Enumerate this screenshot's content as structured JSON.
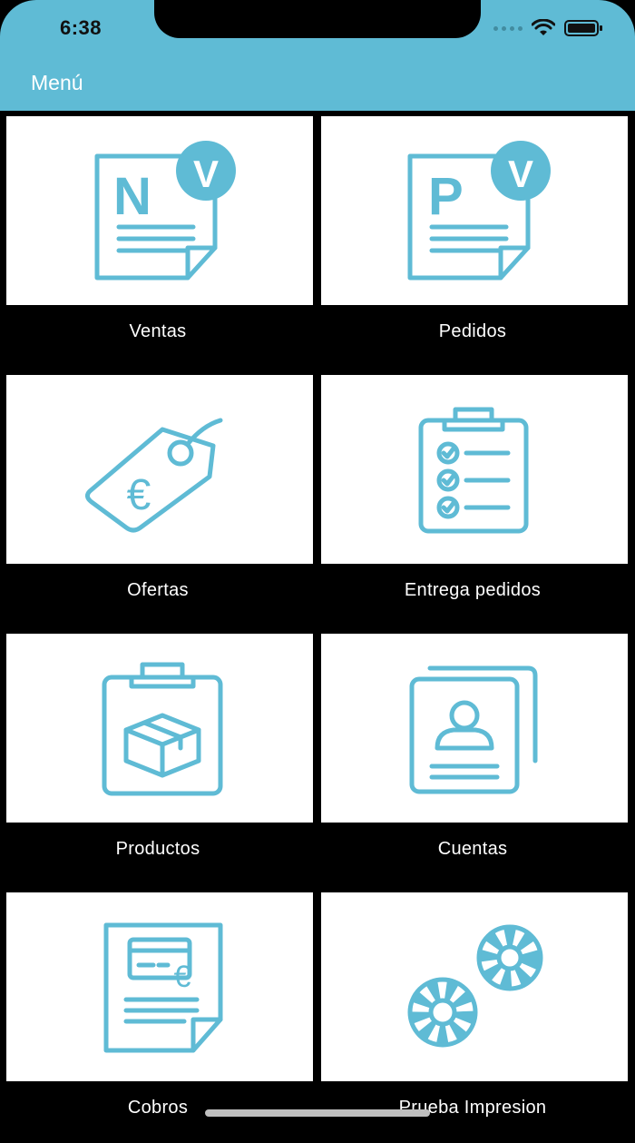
{
  "status_bar": {
    "time": "6:38"
  },
  "header": {
    "title": "Menú"
  },
  "accent_color": "#5fbbd5",
  "menu": {
    "items": [
      {
        "label": "Ventas",
        "icon": "sales-document-icon"
      },
      {
        "label": "Pedidos",
        "icon": "order-document-icon"
      },
      {
        "label": "Ofertas",
        "icon": "price-tag-euro-icon"
      },
      {
        "label": "Entrega pedidos",
        "icon": "checklist-clipboard-icon"
      },
      {
        "label": "Productos",
        "icon": "clipboard-box-icon"
      },
      {
        "label": "Cuentas",
        "icon": "account-cards-icon"
      },
      {
        "label": "Cobros",
        "icon": "payment-document-icon"
      },
      {
        "label": "Prueba Impresion",
        "icon": "gears-icon"
      }
    ]
  }
}
